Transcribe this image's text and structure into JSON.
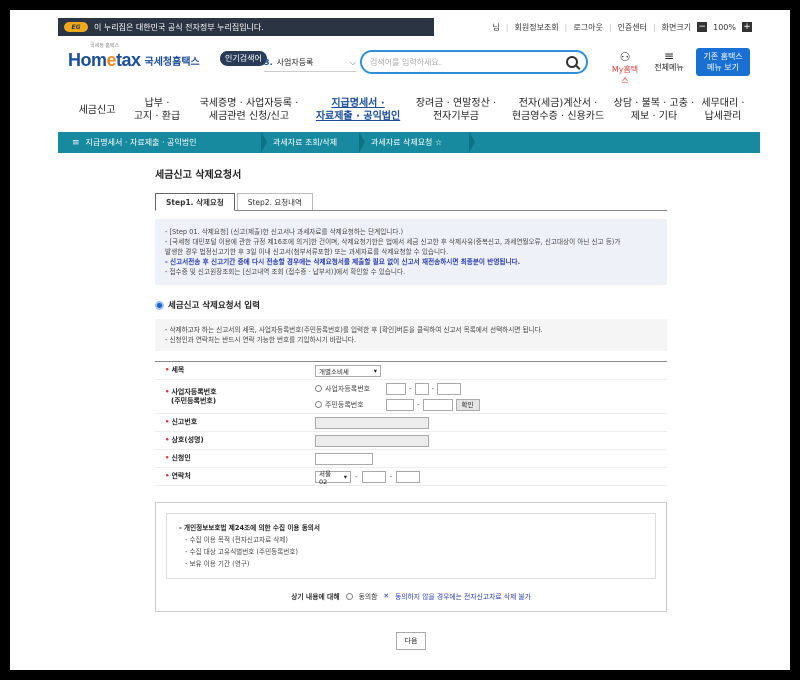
{
  "gov_banner": {
    "logo": "EG",
    "text": "이 누리집은 대한민국 공식 전자정부 누리집입니다."
  },
  "top_util": {
    "user_suffix": "님",
    "member_info": "회원정보조회",
    "logout": "로그아웃",
    "cert_center": "인증센터",
    "screen_size": "화면크기",
    "zoom_minus": "−",
    "zoom": "100%",
    "zoom_plus": "+"
  },
  "header": {
    "logo_small": "국세청 홈택스",
    "logo_main_a": "Hom",
    "logo_main_e": "e",
    "logo_main_b": "tax",
    "logo_sub": "국세청홈택스",
    "hot_badge": "인기검색어",
    "hot_num": "3.",
    "hot_term": "사업자등록",
    "search_placeholder": "검색어를 입력하세요.",
    "my_nts": "My홈택스",
    "all_menu": "전체메뉴",
    "classic_line1": "기존 홈택스",
    "classic_line2": "메뉴 보기"
  },
  "main_nav": [
    {
      "l1": "세금신고",
      "l2": ""
    },
    {
      "l1": "납부 ·",
      "l2": "고지 · 환급"
    },
    {
      "l1": "국세증명 · 사업자등록 ·",
      "l2": "세금관련 신청/신고"
    },
    {
      "l1": "지급명세서 ·",
      "l2": "자료제출 · 공익법인"
    },
    {
      "l1": "장려금 · 연말정산 ·",
      "l2": "전자기부금"
    },
    {
      "l1": "전자(세금)계산서 ·",
      "l2": "현금영수증 · 신용카드"
    },
    {
      "l1": "상담 · 불복 · 고충 ·",
      "l2": "제보 · 기타"
    },
    {
      "l1": "세무대리 ·",
      "l2": "납세관리"
    }
  ],
  "breadcrumb": {
    "menu": "≡",
    "items": [
      "지급명세서 · 자료제출 · 공익법인",
      "과세자료 조회/삭제",
      "과세자료 삭제요청 ☆"
    ]
  },
  "page_title": "세금신고 삭제요청서",
  "tabs": [
    "Step1. 삭제요청",
    "Step2. 요청내역"
  ],
  "notice": {
    "lines": [
      "- [Step 01. 삭제요청] (신고(제출)한 신고서나 과세자료를 삭제요청하는 단계입니다.)",
      "- [국세청 대민포털 이용에 관한 규정 제16조에 의거]한 건이며, 삭제요청기한은 법에서 세금 신고한 후 삭제사유(중복신고, 과세연월오류, 신고대상이 아닌 신고 등)가",
      "  발생한 경우 법정신고기한 후 3일 이내 신고서(첨부서류포함) 또는 과세자료를 삭제요청할 수 있습니다.",
      "- 신고서전송 후 신고기간 중에 다시 전송할 경우에는 삭제요청서를 제출할 필요 없이 신고서 재전송하시면 최종분이 반영됩니다.",
      "- 접수증 및 신고원장조회는 [신고내역 조회 (접수증 · 납부서)]에서 확인할 수 있습니다."
    ]
  },
  "section_title": "세금신고 삭제요청서 입력",
  "guide": [
    "- 삭제하고자 하는 신고서의 세목, 사업자등록번호(주민등록번호)를 입력한 후 [확인]버튼을 클릭하여 신고서 목록에서 선택하시면 됩니다.",
    "- 신청인과 연락처는 반드시 연락 가능한 번호를 기입하시기 바랍니다."
  ],
  "form": {
    "tax_item_label": "세목",
    "tax_item_value": "개별소비세",
    "biz_label_1": "사업자등록번호",
    "biz_label_2": "(주민등록번호)",
    "radio_biz": "사업자등록번호",
    "radio_rrn": "주민등록번호",
    "confirm_btn": "확인",
    "report_no_label": "신고번호",
    "trade_name_label": "상호(성명)",
    "applicant_label": "신청인",
    "contact_label": "연락처",
    "contact_area": "서울 02",
    "dash": "-"
  },
  "consent": {
    "title": "- 개인정보보호법 제24조에 의한 수집 이용 동의서",
    "items": [
      "- 수집 이용 목적 (전자신고자료 삭제)",
      "- 수집 대상 고유식별번호 (주민등록번호)",
      "- 보유 이용 기간 (영구)"
    ],
    "question": "상기 내용에 대해",
    "agree": "동의함",
    "warn": "동의하지 않을 경우에는 전자신고자료 삭제 불가"
  },
  "next_btn": "다음"
}
